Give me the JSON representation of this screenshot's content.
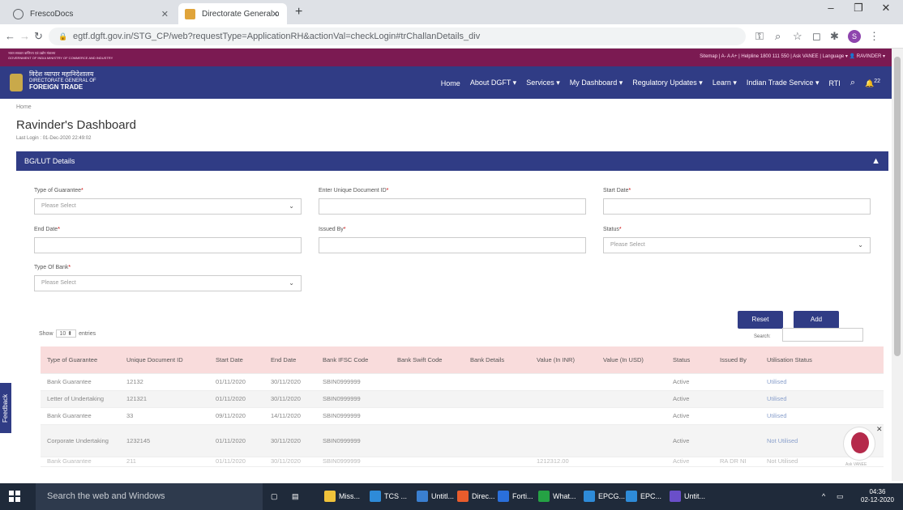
{
  "browser": {
    "tabs": [
      {
        "label": "FrescoDocs",
        "active": false
      },
      {
        "label": "Directorate General of Foreign Tr",
        "active": true
      }
    ],
    "new_tab": "+",
    "url": "egtf.dgft.gov.in/STG_CP/web?requestType=ApplicationRH&actionVal=checkLogin#trChallanDetails_div",
    "window_controls": [
      "–",
      "❐",
      "✕"
    ],
    "profile_initial": "S"
  },
  "site": {
    "gov_line1": "भारत सरकार  वाणिज्य एवं उद्योग मंत्रालय",
    "gov_line2": "GOVERNMENT OF INDIA  MINISTRY OF COMMERCE AND INDUSTRY",
    "top_links": "Sitemap  |  A-  A  A+  |  Helpline 1800 111 550  |  Ask VANEE  |  Language  ▾   👤 RAVINDER  ▾",
    "logo_hindi": "विदेश व्यापार महानिदेशालय",
    "logo_line2": "DIRECTORATE GENERAL OF",
    "logo_line3": "FOREIGN TRADE",
    "nav": [
      "Home",
      "About DGFT ▾",
      "Services ▾",
      "My Dashboard ▾",
      "Regulatory Updates ▾",
      "Learn ▾",
      "Indian Trade Service ▾",
      "RTI"
    ],
    "notif_count": "22"
  },
  "page": {
    "breadcrumb": "Home",
    "title": "Ravinder's Dashboard",
    "last_login": "Last Login : 01-Dec-2020 22:49:02",
    "panel_title": "BG/LUT Details",
    "fields": {
      "type_guarantee_label": "Type of Guarantee",
      "type_guarantee_value": "Please Select",
      "udid_label": "Enter Unique Document ID",
      "start_date_label": "Start Date",
      "end_date_label": "End Date",
      "issued_by_label": "Issued By",
      "status_label": "Status",
      "status_value": "Please Select",
      "type_bank_label": "Type Of Bank",
      "type_bank_value": "Please Select"
    },
    "reset_label": "Reset",
    "add_label": "Add",
    "show_label": "Show",
    "show_value": "10",
    "entries_label": "entries",
    "search_label": "Search:"
  },
  "table": {
    "headers": [
      "Type of Guarantee",
      "Unique Document ID",
      "Start Date",
      "End Date",
      "Bank IFSC Code",
      "Bank Swift Code",
      "Bank Details",
      "Value (In INR)",
      "Value (In USD)",
      "Status",
      "Issued By",
      "Utilisation Status"
    ],
    "rows": [
      [
        "Bank Guarantee",
        "12132",
        "01/11/2020",
        "30/11/2020",
        "SBIN0999999",
        "",
        "",
        "",
        "",
        "Active",
        "",
        "Utilised"
      ],
      [
        "Letter of Undertaking",
        "121321",
        "01/11/2020",
        "30/11/2020",
        "SBIN0999999",
        "",
        "",
        "",
        "",
        "Active",
        "",
        "Utilised"
      ],
      [
        "Bank Guarantee",
        "33",
        "09/11/2020",
        "14/11/2020",
        "SBIN0999999",
        "",
        "",
        "",
        "",
        "Active",
        "",
        "Utilised"
      ],
      [
        "Corporate Undertaking",
        "1232145",
        "01/11/2020",
        "30/11/2020",
        "SBIN0999999",
        "",
        "",
        "",
        "",
        "Active",
        "",
        "Not Utilised"
      ],
      [
        "Bank Guarantee",
        "211",
        "01/11/2020",
        "30/11/2020",
        "SBIN0999999",
        "",
        "",
        "1212312.00",
        "",
        "Active",
        "RA DR NI",
        "Not Utilised"
      ]
    ]
  },
  "widgets": {
    "feedback": "Feedback",
    "chatbot_label": "Ask VANEE",
    "chatbot_close": "✕"
  },
  "taskbar": {
    "search": "Search the web and Windows",
    "apps": [
      "Miss...",
      "TCS ...",
      "Untitl...",
      "Direc...",
      "Forti...",
      "What...",
      "EPCG...",
      "EPC...",
      "Untit..."
    ],
    "time": "04:36",
    "date": "02-12-2020"
  },
  "colors": {
    "nav_blue": "#303c85",
    "strip_maroon": "#7b1a52",
    "header_pink": "#f9dcdc"
  }
}
